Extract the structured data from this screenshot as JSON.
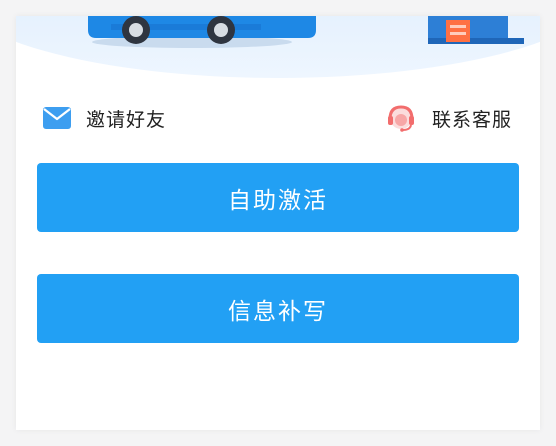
{
  "links": {
    "invite_label": "邀请好友",
    "support_label": "联系客服"
  },
  "buttons": {
    "activate_label": "自助激活",
    "supplement_label": "信息补写"
  },
  "colors": {
    "primary": "#22a0f4",
    "envelope": "#3d9ef0",
    "headset": "#f26d6d",
    "hero_bg": "#e8f2fd",
    "car_body": "#1e88e5"
  },
  "icons": {
    "invite": "envelope-icon",
    "support": "headset-icon"
  }
}
